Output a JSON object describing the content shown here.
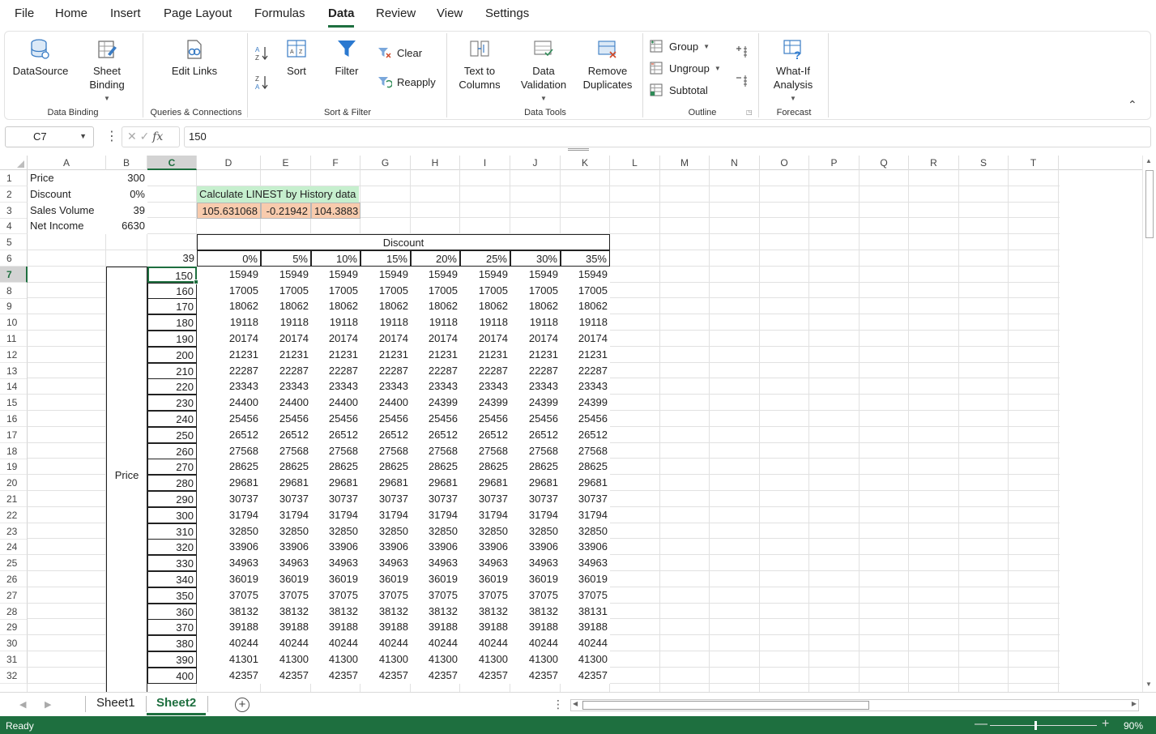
{
  "menu": {
    "items": [
      "File",
      "Home",
      "Insert",
      "Page Layout",
      "Formulas",
      "Data",
      "Review",
      "View",
      "Settings"
    ],
    "active": "Data"
  },
  "ribbon": {
    "datasource": "DataSource",
    "sheet_binding": "Sheet Binding",
    "group_data_binding": "Data Binding",
    "edit_links": "Edit Links",
    "group_queries": "Queries & Connections",
    "sort": "Sort",
    "filter": "Filter",
    "clear": "Clear",
    "reapply": "Reapply",
    "group_sort_filter": "Sort & Filter",
    "text_to_columns": "Text to Columns",
    "data_validation": "Data Validation",
    "remove_duplicates": "Remove Duplicates",
    "group_data_tools": "Data Tools",
    "group": "Group",
    "ungroup": "Ungroup",
    "subtotal": "Subtotal",
    "group_outline": "Outline",
    "what_if": "What-If Analysis",
    "group_forecast": "Forecast"
  },
  "formula_bar": {
    "name_box": "C7",
    "formula": "150"
  },
  "grid": {
    "columns": [
      "A",
      "B",
      "C",
      "D",
      "E",
      "F",
      "G",
      "H",
      "I",
      "J",
      "K",
      "L",
      "M",
      "N",
      "O",
      "P",
      "Q",
      "R",
      "S",
      "T"
    ],
    "selected_column": "C",
    "rows": [
      "1",
      "2",
      "3",
      "4",
      "5",
      "6",
      "7",
      "8",
      "9",
      "10",
      "11",
      "12",
      "13",
      "14",
      "15",
      "16",
      "17",
      "18",
      "19",
      "20",
      "21",
      "22",
      "23",
      "24",
      "25",
      "26",
      "27",
      "28",
      "29",
      "30",
      "31",
      "32"
    ],
    "selected_row": "7",
    "inputs": [
      {
        "label": "Price",
        "value": "300"
      },
      {
        "label": "Discount",
        "value": "0%"
      },
      {
        "label": "Sales Volume",
        "value": "39"
      },
      {
        "label": "Net Income",
        "value": "6630"
      }
    ],
    "linest_title": "Calculate LINEST by History data",
    "linest_values": [
      "105.631068",
      "-0.21942",
      "104.3883"
    ],
    "table_title": "Discount",
    "row_axis_label": "Price",
    "corner_value": "39",
    "discount_headers": [
      "0%",
      "5%",
      "10%",
      "15%",
      "20%",
      "25%",
      "30%",
      "35%"
    ],
    "price_values": [
      "150",
      "160",
      "170",
      "180",
      "190",
      "200",
      "210",
      "220",
      "230",
      "240",
      "250",
      "260",
      "270",
      "280",
      "290",
      "300",
      "310",
      "320",
      "330",
      "340",
      "350",
      "360",
      "370",
      "380",
      "390",
      "400"
    ],
    "table_rows": [
      [
        "15949",
        "15949",
        "15949",
        "15949",
        "15949",
        "15949",
        "15949",
        "15949"
      ],
      [
        "17005",
        "17005",
        "17005",
        "17005",
        "17005",
        "17005",
        "17005",
        "17005"
      ],
      [
        "18062",
        "18062",
        "18062",
        "18062",
        "18062",
        "18062",
        "18062",
        "18062"
      ],
      [
        "19118",
        "19118",
        "19118",
        "19118",
        "19118",
        "19118",
        "19118",
        "19118"
      ],
      [
        "20174",
        "20174",
        "20174",
        "20174",
        "20174",
        "20174",
        "20174",
        "20174"
      ],
      [
        "21231",
        "21231",
        "21231",
        "21231",
        "21231",
        "21231",
        "21231",
        "21231"
      ],
      [
        "22287",
        "22287",
        "22287",
        "22287",
        "22287",
        "22287",
        "22287",
        "22287"
      ],
      [
        "23343",
        "23343",
        "23343",
        "23343",
        "23343",
        "23343",
        "23343",
        "23343"
      ],
      [
        "24400",
        "24400",
        "24400",
        "24400",
        "24399",
        "24399",
        "24399",
        "24399"
      ],
      [
        "25456",
        "25456",
        "25456",
        "25456",
        "25456",
        "25456",
        "25456",
        "25456"
      ],
      [
        "26512",
        "26512",
        "26512",
        "26512",
        "26512",
        "26512",
        "26512",
        "26512"
      ],
      [
        "27568",
        "27568",
        "27568",
        "27568",
        "27568",
        "27568",
        "27568",
        "27568"
      ],
      [
        "28625",
        "28625",
        "28625",
        "28625",
        "28625",
        "28625",
        "28625",
        "28625"
      ],
      [
        "29681",
        "29681",
        "29681",
        "29681",
        "29681",
        "29681",
        "29681",
        "29681"
      ],
      [
        "30737",
        "30737",
        "30737",
        "30737",
        "30737",
        "30737",
        "30737",
        "30737"
      ],
      [
        "31794",
        "31794",
        "31794",
        "31794",
        "31794",
        "31794",
        "31794",
        "31794"
      ],
      [
        "32850",
        "32850",
        "32850",
        "32850",
        "32850",
        "32850",
        "32850",
        "32850"
      ],
      [
        "33906",
        "33906",
        "33906",
        "33906",
        "33906",
        "33906",
        "33906",
        "33906"
      ],
      [
        "34963",
        "34963",
        "34963",
        "34963",
        "34963",
        "34963",
        "34963",
        "34963"
      ],
      [
        "36019",
        "36019",
        "36019",
        "36019",
        "36019",
        "36019",
        "36019",
        "36019"
      ],
      [
        "37075",
        "37075",
        "37075",
        "37075",
        "37075",
        "37075",
        "37075",
        "37075"
      ],
      [
        "38132",
        "38132",
        "38132",
        "38132",
        "38132",
        "38132",
        "38132",
        "38131"
      ],
      [
        "39188",
        "39188",
        "39188",
        "39188",
        "39188",
        "39188",
        "39188",
        "39188"
      ],
      [
        "40244",
        "40244",
        "40244",
        "40244",
        "40244",
        "40244",
        "40244",
        "40244"
      ],
      [
        "41301",
        "41300",
        "41300",
        "41300",
        "41300",
        "41300",
        "41300",
        "41300"
      ],
      [
        "42357",
        "42357",
        "42357",
        "42357",
        "42357",
        "42357",
        "42357",
        "42357"
      ]
    ]
  },
  "sheets": {
    "tabs": [
      "Sheet1",
      "Sheet2"
    ],
    "active": "Sheet2"
  },
  "status": {
    "text": "Ready",
    "zoom": "90%"
  },
  "colors": {
    "accent": "#1e6f3f",
    "linest_title_bg": "#c6efce",
    "linest_values_bg": "#f8cbad"
  }
}
